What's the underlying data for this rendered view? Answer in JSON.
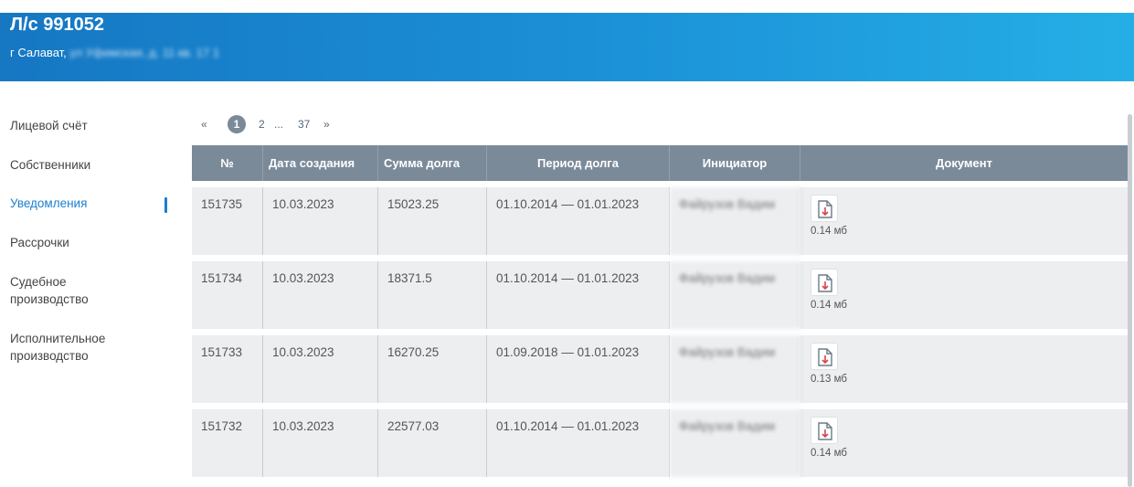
{
  "header": {
    "account": "Л/с 991052",
    "city": "г Салават,",
    "street_obscured": "ул Уфимская, д. 11 кв. 17 1"
  },
  "sidebar": {
    "items": [
      {
        "label": "Лицевой счёт"
      },
      {
        "label": "Собственники"
      },
      {
        "label": "Уведомления"
      },
      {
        "label": "Рассрочки"
      },
      {
        "label": "Судебное\nпроизводство"
      },
      {
        "label": "Исполнительное\nпроизводство"
      }
    ],
    "active_index": 2
  },
  "pagination": {
    "prev": "«",
    "current": "1",
    "next_page": "2",
    "ellipsis": "...",
    "last": "37",
    "next": "»"
  },
  "table": {
    "headers": [
      "№",
      "Дата создания",
      "Сумма долга",
      "Период долга",
      "Инициатор",
      "Документ"
    ],
    "rows": [
      {
        "num": "151735",
        "date": "10.03.2023",
        "sum": "15023.25",
        "period": "01.10.2014 — 01.01.2023",
        "initiator": "Файрузов Вадим",
        "size": "0.14 мб"
      },
      {
        "num": "151734",
        "date": "10.03.2023",
        "sum": "18371.5",
        "period": "01.10.2014 — 01.01.2023",
        "initiator": "Файрузов Вадим",
        "size": "0.14 мб"
      },
      {
        "num": "151733",
        "date": "10.03.2023",
        "sum": "16270.25",
        "period": "01.09.2018 — 01.01.2023",
        "initiator": "Файрузов Вадим",
        "size": "0.13 мб"
      },
      {
        "num": "151732",
        "date": "10.03.2023",
        "sum": "22577.03",
        "period": "01.10.2014 — 01.01.2023",
        "initiator": "Файрузов Вадим",
        "size": "0.14 мб"
      }
    ]
  },
  "colors": {
    "header_start": "#1677c3",
    "header_end": "#25aee6",
    "accent": "#1a7fd0",
    "table_head": "#7b8a99",
    "row_bg": "#eceef0"
  },
  "icons": {
    "document": "pdf-file-icon"
  }
}
